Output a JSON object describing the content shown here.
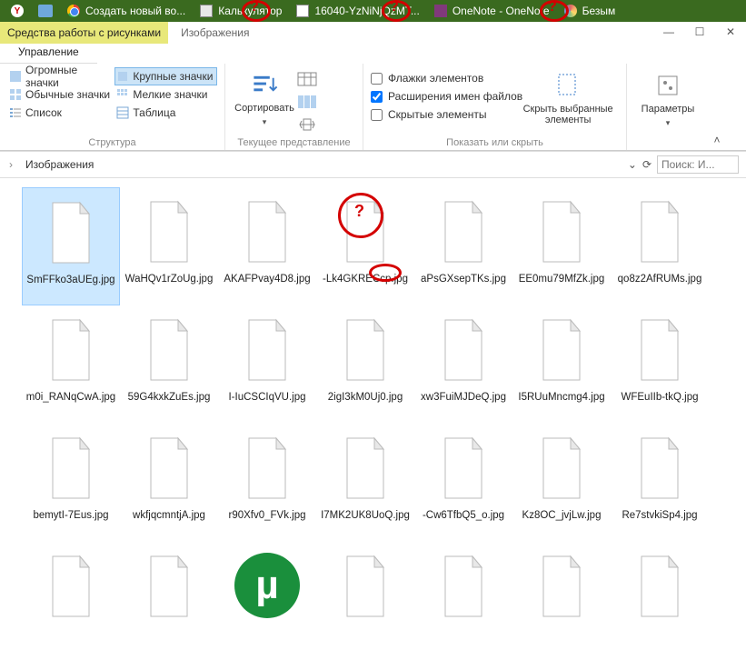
{
  "taskbar": {
    "items": [
      {
        "label": ""
      },
      {
        "label": ""
      },
      {
        "label": "Создать новый во..."
      },
      {
        "label": "Калькулятор"
      },
      {
        "label": "16040-YzNiNjQzMT..."
      },
      {
        "label": "OneNote - OneNote"
      },
      {
        "label": "Безым"
      }
    ]
  },
  "ribbon": {
    "context_tab": "Средства работы с рисунками",
    "tab_images": "Изображения",
    "subtab_manage": "Управление",
    "views": {
      "huge": "Огромные значки",
      "large": "Крупные значки",
      "normal": "Обычные значки",
      "small": "Мелкие значки",
      "list": "Список",
      "table": "Таблица"
    },
    "group_layout": "Структура",
    "sort": "Сортировать",
    "group_current": "Текущее представление",
    "check_flags": "Флажки элементов",
    "check_ext": "Расширения имен файлов",
    "check_hidden": "Скрытые элементы",
    "hide_selected_1": "Скрыть выбранные",
    "hide_selected_2": "элементы",
    "params": "Параметры",
    "group_show": "Показать или скрыть"
  },
  "address": {
    "crumb": "Изображения",
    "search_placeholder": "Поиск: И..."
  },
  "files": [
    {
      "name": "SmFFko3aUEg.jpg",
      "selected": true
    },
    {
      "name": "WaHQv1rZoUg.jpg"
    },
    {
      "name": "AKAFPvay4D8.jpg"
    },
    {
      "name": "-Lk4GKRECcp.jpg",
      "annot": true
    },
    {
      "name": "aPsGXsepTKs.jpg"
    },
    {
      "name": "EE0mu79MfZk.jpg"
    },
    {
      "name": "qo8z2AfRUMs.jpg"
    },
    {
      "name": "m0i_RANqCwA.jpg"
    },
    {
      "name": "59G4kxkZuEs.jpg"
    },
    {
      "name": "I-IuCSCIqVU.jpg"
    },
    {
      "name": "2igI3kM0Uj0.jpg"
    },
    {
      "name": "xw3FuiMJDeQ.jpg"
    },
    {
      "name": "I5RUuMncmg4.jpg"
    },
    {
      "name": "WFEuIIb-tkQ.jpg"
    },
    {
      "name": "bemytI-7Eus.jpg"
    },
    {
      "name": "wkfjqcmntjA.jpg"
    },
    {
      "name": "r90Xfv0_FVk.jpg"
    },
    {
      "name": "I7MK2UK8UoQ.jpg"
    },
    {
      "name": "-Cw6TfbQ5_o.jpg"
    },
    {
      "name": "Kz8OC_jvjLw.jpg"
    },
    {
      "name": "Re7stvkiSp4.jpg"
    },
    {
      "name": ""
    },
    {
      "name": ""
    },
    {
      "name": "",
      "utorrent": true
    },
    {
      "name": ""
    },
    {
      "name": ""
    },
    {
      "name": ""
    },
    {
      "name": ""
    }
  ]
}
